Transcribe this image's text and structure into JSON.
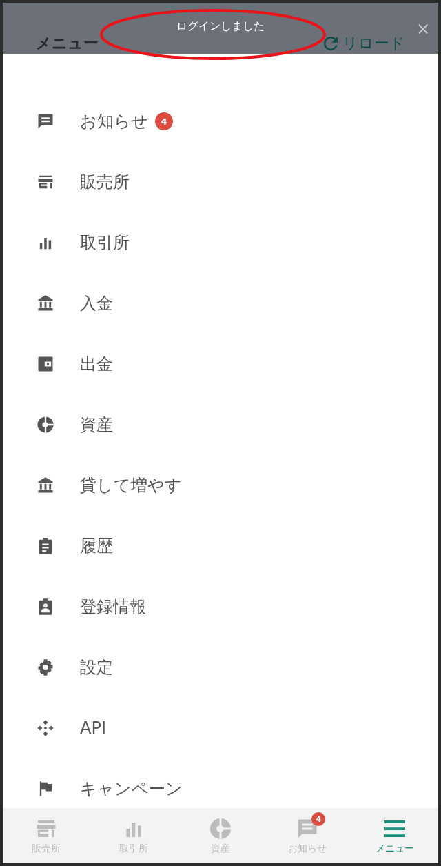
{
  "header": {
    "title": "メニュー",
    "reload": "リロード",
    "close": "×"
  },
  "toast": {
    "message": "ログインしました"
  },
  "menu": [
    {
      "label": "お知らせ",
      "badge": "4"
    },
    {
      "label": "販売所"
    },
    {
      "label": "取引所"
    },
    {
      "label": "入金"
    },
    {
      "label": "出金"
    },
    {
      "label": "資産"
    },
    {
      "label": "貸して増やす"
    },
    {
      "label": "履歴"
    },
    {
      "label": "登録情報"
    },
    {
      "label": "設定"
    },
    {
      "label": "API"
    },
    {
      "label": "キャンペーン"
    }
  ],
  "bottom_nav": [
    {
      "label": "販売所",
      "selected": false
    },
    {
      "label": "取引所",
      "selected": false
    },
    {
      "label": "資産",
      "selected": false
    },
    {
      "label": "お知らせ",
      "selected": false,
      "badge": "4"
    },
    {
      "label": "メニュー",
      "selected": true
    }
  ]
}
